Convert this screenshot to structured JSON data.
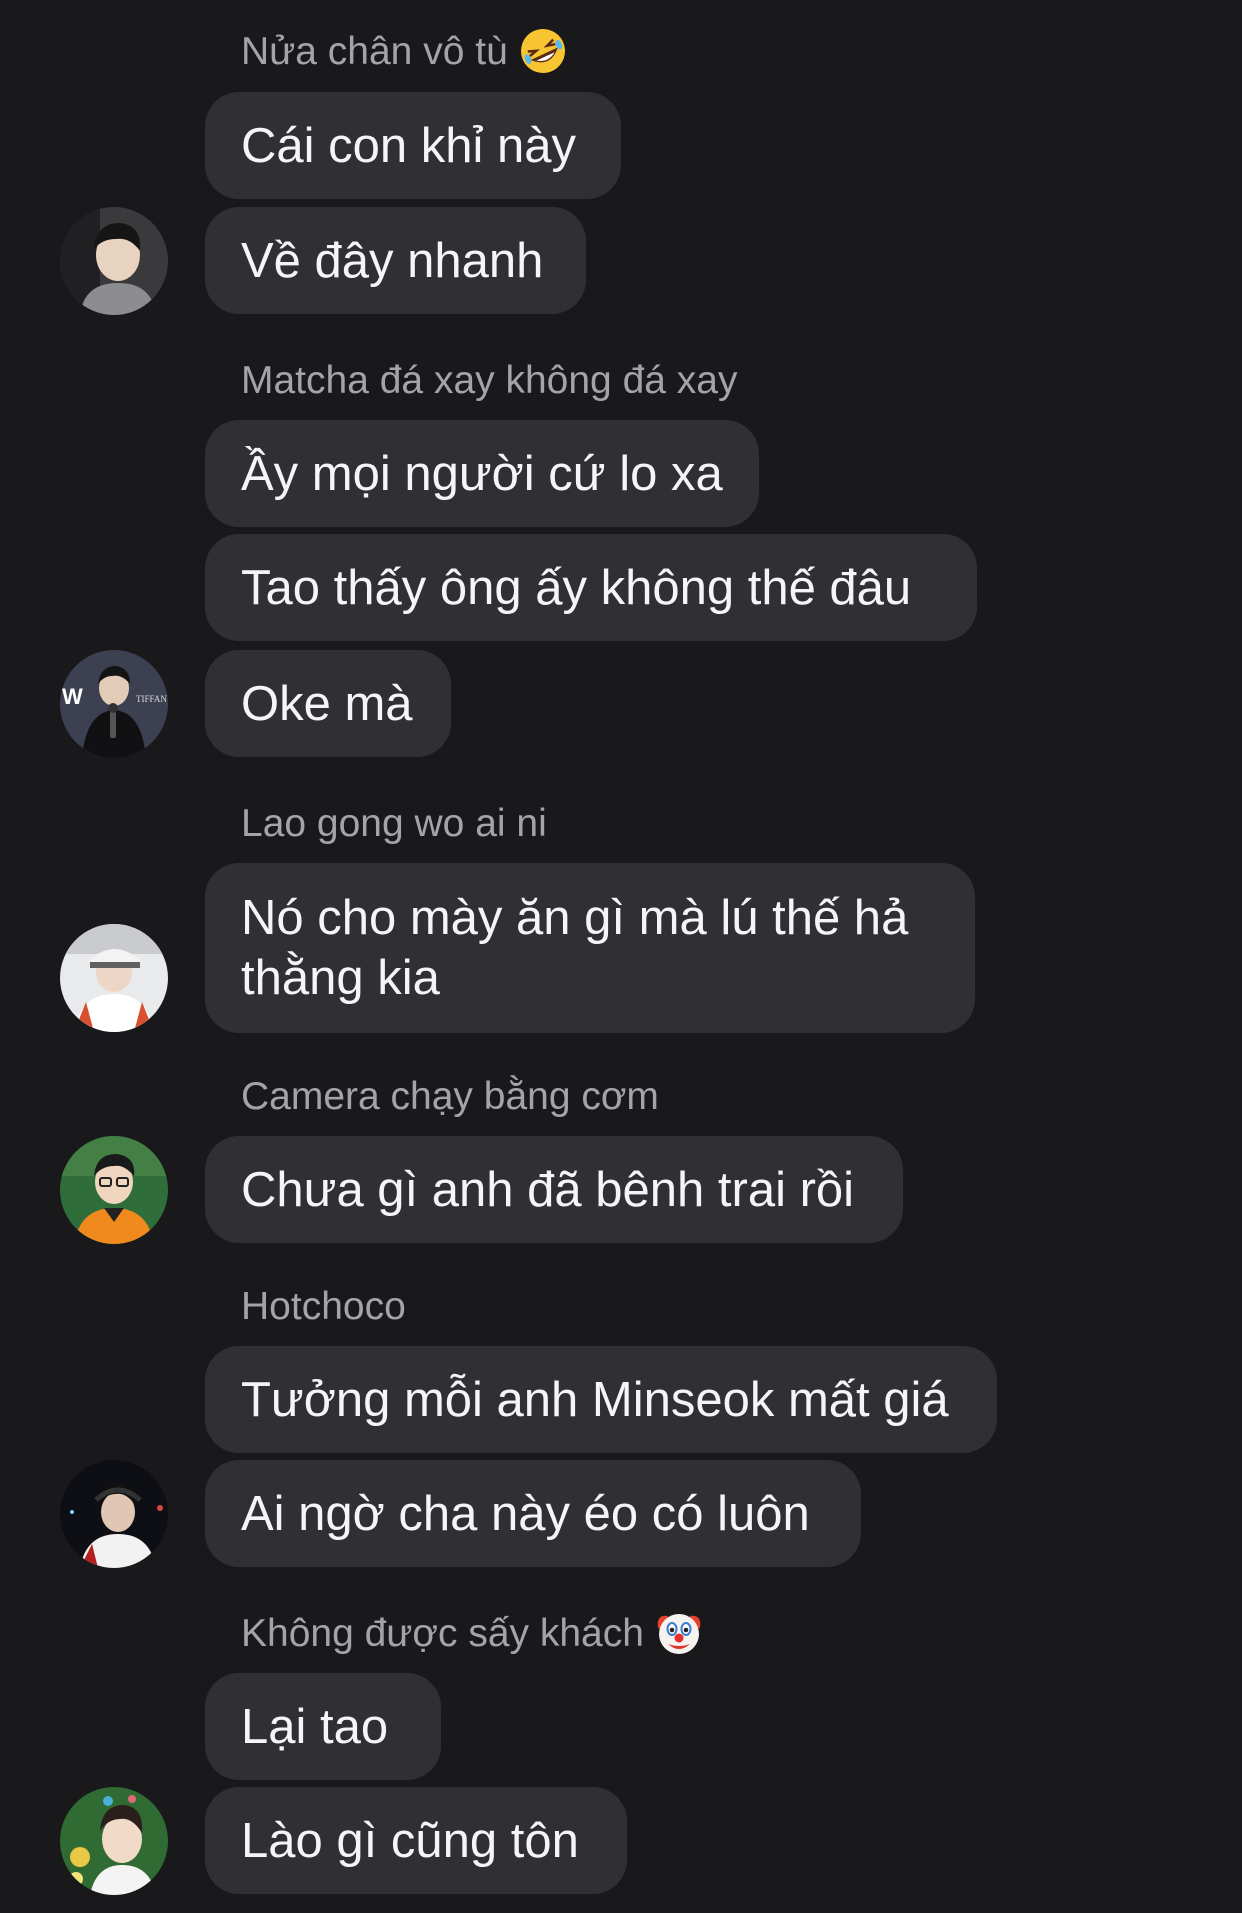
{
  "messages": [
    {
      "sender": "Nửa chân vô tù",
      "sender_emoji": "rofl-emoji",
      "avatar": "avatar-user-1",
      "bubbles": [
        "Cái con khỉ này",
        "Về đây nhanh"
      ]
    },
    {
      "sender": "Matcha đá xay không đá xay",
      "avatar": "avatar-user-2",
      "bubbles": [
        "Ầy mọi người cứ lo xa",
        "Tao thấy ông ấy không thế đâu",
        "Oke mà"
      ]
    },
    {
      "sender": "Lao gong wo ai ni",
      "avatar": "avatar-user-3",
      "bubbles": [
        "Nó cho mày ăn gì mà lú thế hả thằng kia"
      ]
    },
    {
      "sender": "Camera chạy bằng cơm",
      "avatar": "avatar-user-4",
      "bubbles": [
        "Chưa gì anh đã bênh trai rồi"
      ]
    },
    {
      "sender": "Hotchoco",
      "avatar": "avatar-user-5",
      "bubbles": [
        "Tưởng mỗi anh Minseok mất giá",
        "Ai ngờ cha này éo có luôn"
      ]
    },
    {
      "sender": "Không được sấy khách",
      "sender_emoji": "clown-emoji",
      "avatar": "avatar-user-6",
      "bubbles": [
        "Lại tao",
        "Lào gì cũng tôn"
      ]
    }
  ],
  "colors": {
    "background": "#19191b",
    "bubble": "#303033",
    "sender_name": "#a3a3aa",
    "text": "#f5f5f7"
  }
}
